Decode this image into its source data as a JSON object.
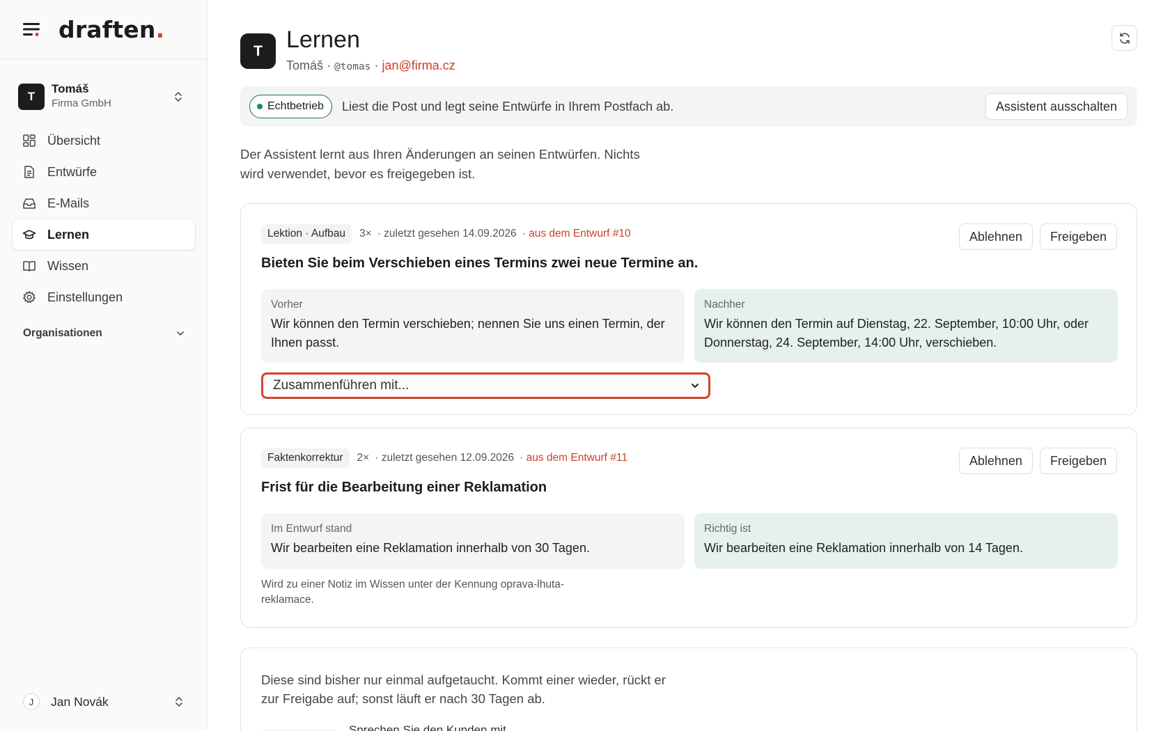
{
  "app": {
    "logo_text": "draften",
    "logo_dot": ".",
    "accent": "#d64532"
  },
  "account": {
    "initial": "T",
    "name": "Tomáš",
    "org": "Firma GmbH"
  },
  "nav": {
    "items": [
      {
        "label": "Übersicht",
        "icon": "grid-icon",
        "active": false
      },
      {
        "label": "Entwürfe",
        "icon": "document-icon",
        "active": false
      },
      {
        "label": "E-Mails",
        "icon": "inbox-icon",
        "active": false
      },
      {
        "label": "Lernen",
        "icon": "graduation-cap-icon",
        "active": true
      },
      {
        "label": "Wissen",
        "icon": "book-icon",
        "active": false
      },
      {
        "label": "Einstellungen",
        "icon": "gear-icon",
        "active": false
      }
    ],
    "organisations_label": "Organisationen"
  },
  "user": {
    "initial": "J",
    "name": "Jan Novák"
  },
  "page": {
    "initial": "T",
    "title": "Lernen",
    "subtitle_name": "Tomáš",
    "subtitle_handle": "@tomas",
    "subtitle_email": "jan@firma.cz"
  },
  "status": {
    "badge": "Echtbetrieb",
    "text": "Liest die Post und legt seine Entwürfe in Ihrem Postfach ab.",
    "button": "Assistent ausschalten",
    "badge_color": "#1e8a5a"
  },
  "intro": "Der Assistent lernt aus Ihren Änderungen an seinen Entwürfen. Nichts wird verwendet, bevor es freigegeben ist.",
  "cards": [
    {
      "tag": "Lektion · Aufbau",
      "count": "3×",
      "seen": "· zuletzt gesehen 14.09.2026",
      "source": "· aus dem Entwurf #10",
      "reject": "Ablehnen",
      "approve": "Freigeben",
      "title": "Bieten Sie beim Verschieben eines Termins zwei neue Termine an.",
      "before_label": "Vorher",
      "before_text": "Wir können den Termin verschieben; nennen Sie uns einen Termin, der Ihnen passt.",
      "after_label": "Nachher",
      "after_text": "Wir können den Termin auf Dienstag, 22. September, 10:00 Uhr, oder Donnerstag, 24. September, 14:00 Uhr, verschieben.",
      "merge_select": "Zusammenführen mit..."
    },
    {
      "tag": "Faktenkorrektur",
      "count": "2×",
      "seen": "· zuletzt gesehen 12.09.2026",
      "source": "· aus dem Entwurf #11",
      "reject": "Ablehnen",
      "approve": "Freigeben",
      "title": "Frist für die Bearbeitung einer Reklamation",
      "before_label": "Im Entwurf stand",
      "before_text": "Wir bearbeiten eine Reklamation innerhalb von 30 Tagen.",
      "after_label": "Richtig ist",
      "after_text": "Wir bearbeiten eine Reklamation innerhalb von 14 Tagen.",
      "note": "Wird zu einer Notiz im Wissen unter der Kennung oprava-lhuta-reklamace."
    }
  ],
  "pending": {
    "text": "Diese sind bisher nur einmal aufgetaucht. Kommt einer wieder, rückt er zur Freigabe auf; sonst läuft er nach 30 Tagen ab.",
    "peek": "Sprechen Sie den Kunden mit"
  }
}
